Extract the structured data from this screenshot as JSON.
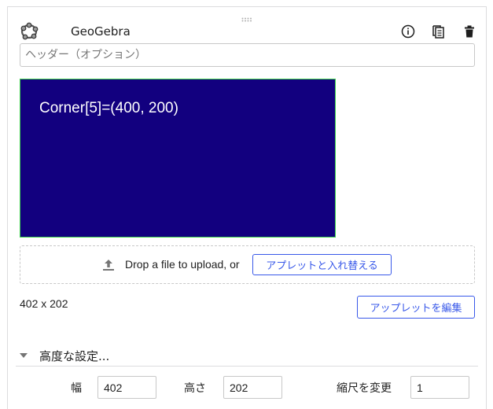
{
  "block": {
    "title": "GeoGebra",
    "header_placeholder": "ヘッダー（オプション）",
    "applet": {
      "text": "Corner[5]=(400, 200)",
      "background": "#12007f",
      "border_color": "#3ed34b"
    },
    "upload": {
      "prompt": "Drop a file to upload, or",
      "replace_label": "アプレットと入れ替える"
    },
    "applet_size": "402 x 202",
    "edit_label": "アップレットを編集",
    "advanced": {
      "label": "高度な設定...",
      "width_label": "幅",
      "width_value": "402",
      "height_label": "高さ",
      "height_value": "202",
      "scale_label": "縮尺を変更",
      "scale_value": "1"
    }
  },
  "colors": {
    "accent": "#3858e9",
    "text": "#1e1e1e",
    "border": "#c8c8c8"
  },
  "icons": [
    "drag-handle-icon",
    "geogebra-logo-icon",
    "info-icon",
    "copy-icon",
    "trash-icon",
    "upload-icon",
    "chevron-down-icon"
  ]
}
